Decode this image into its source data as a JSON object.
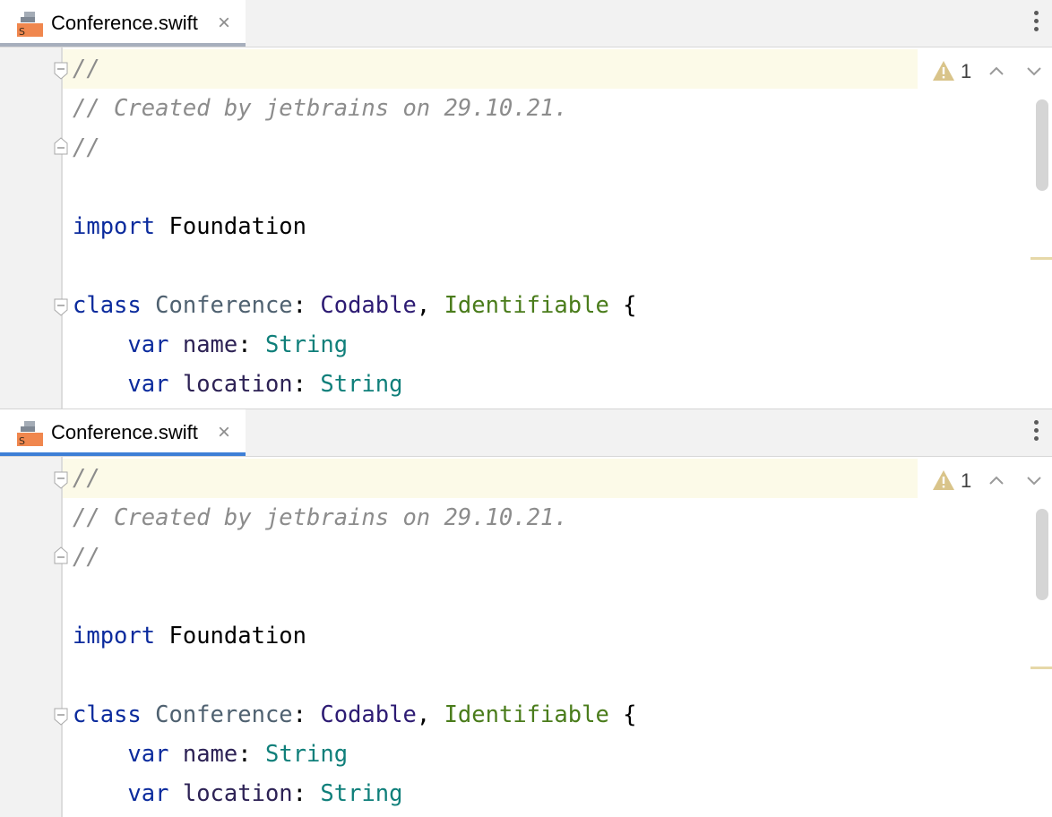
{
  "panes": [
    {
      "tab": {
        "label": "Conference.swift",
        "close_glyph": "×",
        "active": false
      },
      "inspection": {
        "icon": "warning-icon",
        "count": "1"
      },
      "code": {
        "line1": "//",
        "line2": "// Created by jetbrains on 29.10.21.",
        "line3": "//",
        "kw_import": "import",
        "module": "Foundation",
        "kw_class": "class",
        "class_name": "Conference",
        "colon": ":",
        "proto1": "Codable",
        "comma": ",",
        "proto2": "Identifiable",
        "brace": "{",
        "kw_var": "var",
        "var1": "name",
        "type1": "String",
        "var2": "location",
        "type2": "String"
      }
    },
    {
      "tab": {
        "label": "Conference.swift",
        "close_glyph": "×",
        "active": true
      },
      "inspection": {
        "icon": "warning-icon",
        "count": "1"
      },
      "code": {
        "line1": "//",
        "line2": "// Created by jetbrains on 29.10.21.",
        "line3": "//",
        "kw_import": "import",
        "module": "Foundation",
        "kw_class": "class",
        "class_name": "Conference",
        "colon": ":",
        "proto1": "Codable",
        "comma": ",",
        "proto2": "Identifiable",
        "brace": "{",
        "kw_var": "var",
        "var1": "name",
        "type1": "String",
        "var2": "location",
        "type2": "String"
      }
    }
  ],
  "colors": {
    "active_tab_underline": "#3e7fd6",
    "inactive_tab_underline": "#a7afbd",
    "current_line": "#fcfae8",
    "keyword": "#0b2b9d",
    "comment": "#8c8c8c",
    "string_type": "#0f7f7a",
    "warning": "#d9c48a"
  }
}
